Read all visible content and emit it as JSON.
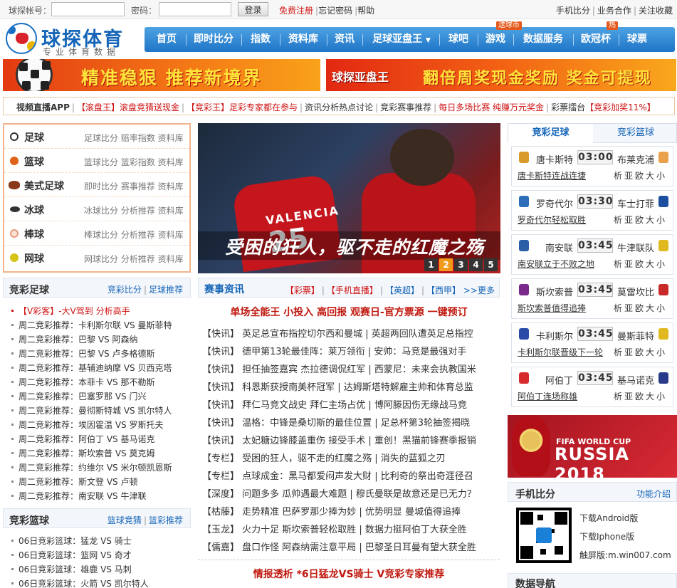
{
  "topbar": {
    "account_label": "球探帐号：",
    "password_label": "密码：",
    "login_button": "登录",
    "register_link": "免费注册",
    "forgot_link": "忘记密码",
    "help_link": "帮助",
    "right_links": [
      "手机比分",
      "业务合作",
      "关注收藏"
    ]
  },
  "logo": {
    "title": "球探体育",
    "subtitle": "专业体育数据"
  },
  "nav": {
    "items": [
      "首页",
      "即时比分",
      "指数",
      "资料库",
      "资讯",
      "足球亚盘王",
      "球吧",
      "游戏",
      "数据服务",
      "欧冠杯",
      "球票"
    ],
    "badge_game": "送球币",
    "badge_ucl": "热"
  },
  "banners": {
    "left_text": "精准稳狠  推荐新境界",
    "right_logo": "球探亚盘王",
    "right_text": "翻倍周奖现金奖励 奖金可提现"
  },
  "ticker": {
    "items": [
      "视频直播APP",
      "【滚盘王】滚盘竞猜送现金",
      "【竞彩王】足彩专家都在参与",
      "资讯分析热点讨论",
      "竞彩赛事推荐",
      "每日多场比赛 纯赚万元奖金",
      "彩票擂台",
      "【竞彩加奖11%】"
    ]
  },
  "sports": [
    {
      "name": "足球",
      "links": "足球比分 赔率指数 资料库",
      "color": "#333333"
    },
    {
      "name": "篮球",
      "links": "篮球比分 篮彩指数 资料库",
      "color": "#e0621a"
    },
    {
      "name": "美式足球",
      "links": "即时比分 赛事推荐 资料库",
      "color": "#8a3a1a"
    },
    {
      "name": "冰球",
      "links": "冰球比分 分析推荐 资料库",
      "color": "#333333"
    },
    {
      "name": "棒球",
      "links": "棒球比分 分析推荐 资料库",
      "color": "#e89a7a"
    },
    {
      "name": "网球",
      "links": "网球比分 分析推荐 资料库",
      "color": "#d6c315"
    }
  ],
  "slide": {
    "caption": "受困的狂人，驱不走的红魔之殇",
    "pages": [
      "1",
      "2",
      "3",
      "4",
      "5"
    ],
    "active_page": "2",
    "shirt_name": "VALENCIA",
    "shirt_number": "25"
  },
  "jc_football": {
    "title": "竞彩足球",
    "links": [
      "竞彩比分",
      "足球推荐"
    ],
    "highlight": "【V彩客】-大V驾到 分析高手",
    "items": [
      "周二竞彩推荐：卡利斯尔联 VS 曼斯菲特",
      "周二竞彩推荐：巴黎 VS 阿森纳",
      "周二竞彩推荐：巴黎 VS 卢多格德斯",
      "周二竞彩推荐：基辅迪纳摩 VS 贝西克塔",
      "周二竞彩推荐：本菲卡 VS 那不勒斯",
      "周二竞彩推荐：巴塞罗那 VS 门兴",
      "周二竞彩推荐：曼彻斯特城 VS 凯尔特人",
      "周二竞彩推荐：埃因霍温 VS 罗斯托夫",
      "周二竞彩推荐：阿伯丁 VS 基马诺克",
      "周二竞彩推荐：斯坎索普 VS 莫克姆",
      "周二竞彩推荐：约维尔 VS 米尔顿凯恩斯",
      "周二竞彩推荐：斯文登 VS 卢顿",
      "周二竞彩推荐：南安联 VS 牛津联"
    ]
  },
  "jc_basketball": {
    "title": "竞彩篮球",
    "links": [
      "篮球竞猜",
      "篮彩推荐"
    ],
    "items": [
      "06日竞彩篮球：猛龙 VS 骑士",
      "06日竞彩篮球：篮网 VS 奇才",
      "06日竞彩篮球：雄鹿 VS 马刺",
      "06日竞彩篮球：火箭 VS 凯尔特人"
    ]
  },
  "news": {
    "title": "赛事资讯",
    "tags": [
      "【彩票】",
      "【手机直播】",
      "【英超】",
      "【西甲】"
    ],
    "more": ">>更多",
    "headline": "单场全能王 小投入 高回报   观赛日-官方票源 一键预订",
    "rows": [
      {
        "k": "【快讯】",
        "t": "英足总宣布指控切尔西和曼城 | 英超两回队遭英足总指控"
      },
      {
        "k": "【快讯】",
        "t": "德甲第13轮最佳阵：莱万领衔 | 安帅：马竞是最强对手"
      },
      {
        "k": "【快讯】",
        "t": "担任抽签嘉宾 杰拉德调侃红军 | 西蒙尼：未来会执教国米"
      },
      {
        "k": "【快讯】",
        "t": "科恩斯获授南美杯冠军 | 达姆斯塔特解雇主帅和体育总监"
      },
      {
        "k": "【快讯】",
        "t": "拜仁马竞文战史 拜仁主场占优 | 博阿滕因伤无缘战马竞"
      },
      {
        "k": "【快讯】",
        "t": "温格：中锋是桑切斯的最佳位置 | 足总杯第3轮抽签揭晓"
      },
      {
        "k": "【快讯】",
        "t": "太妃糖边锋膝盖重伤 接受手术 | 重创！黑猫前锋赛季报销"
      },
      {
        "k": "【专栏】",
        "t": "受困的狂人，驱不走的红魔之殇 | 消失的蓝狐之刃"
      },
      {
        "k": "【专栏】",
        "t": "点球成金：黑马都爱闷声发大财 | 比利奇的祭出奇涯径召"
      },
      {
        "k": "【深度】",
        "t": "问题多多 瓜帅遇最大难题 | 穆氏曼联是故意还是已无力？"
      },
      {
        "k": "【枯藤】",
        "t": "走势精准 巴萨罗那少捧为妙 | 优势明显 曼城值得追捧"
      },
      {
        "k": "【玉龙】",
        "t": "火力十足 斯坎索普轻松取胜 | 数据力挺阿伯丁大获全胜"
      },
      {
        "k": "【儒嘉】",
        "t": "盘口作怪 阿森纳需注意平局 | 巴黎圣日耳曼有望大获全胜"
      }
    ],
    "footer": "情报透析 *6日猛龙VS骑士   V竞彩专家推荐"
  },
  "right_tabs": [
    "竞彩足球",
    "竞彩篮球"
  ],
  "matches": [
    {
      "home": "唐卡斯特",
      "time": "03:00",
      "away": "布莱克浦",
      "link": "唐卡斯特连战连捷",
      "ops": "析亚欧大小",
      "c1": "#d89a2a",
      "c2": "#e9a04a"
    },
    {
      "home": "罗奇代尔",
      "time": "03:30",
      "away": "车士打菲",
      "link": "罗奇代尔轻松取胜",
      "ops": "析亚欧大小",
      "c1": "#2c6fb8",
      "c2": "#1c4fa0"
    },
    {
      "home": "南安联",
      "time": "03:45",
      "away": "牛津联队",
      "link": "南安联立于不败之地",
      "ops": "析亚欧大小",
      "c1": "#2a5fa8",
      "c2": "#e0b820"
    },
    {
      "home": "斯坎索普",
      "time": "03:45",
      "away": "莫雷坎比",
      "link": "斯坎索普值得追捧",
      "ops": "析亚欧大小",
      "c1": "#7a2a8a",
      "c2": "#c82a2a"
    },
    {
      "home": "卡利斯尔",
      "time": "03:45",
      "away": "曼斯菲特",
      "link": "卡利斯尔联晋级下一轮",
      "ops": "析亚欧大小",
      "c1": "#2a4aa8",
      "c2": "#e0b820"
    },
    {
      "home": "阿伯丁",
      "time": "03:45",
      "away": "基马诺克",
      "link": "阿伯丁连场称雄",
      "ops": "析亚欧大小",
      "c1": "#d82a2a",
      "c2": "#2a3a8a"
    }
  ],
  "wc": {
    "line1": "FIFA WORLD CUP",
    "line2": "RUSSIA 2018"
  },
  "mobile": {
    "title": "手机比分",
    "link": "功能介绍",
    "android": "下载Android版",
    "iphone": "下载Iphone版",
    "touch": "触屏版:m.win007.com"
  },
  "data_nav": {
    "title": "数据导航"
  }
}
